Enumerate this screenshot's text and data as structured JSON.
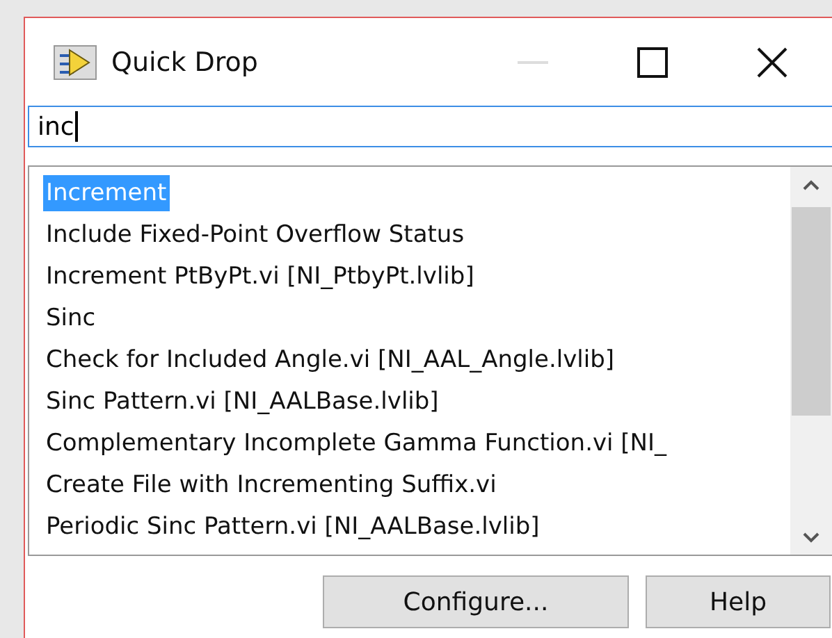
{
  "window": {
    "title": "Quick Drop",
    "minimize_disabled": true
  },
  "search": {
    "value": "inc"
  },
  "results": [
    {
      "label": "Increment",
      "selected": true
    },
    {
      "label": "Include Fixed-Point Overflow Status",
      "selected": false
    },
    {
      "label": "Increment PtByPt.vi [NI_PtbyPt.lvlib]",
      "selected": false
    },
    {
      "label": "Sinc",
      "selected": false
    },
    {
      "label": "Check for Included Angle.vi [NI_AAL_Angle.lvlib]",
      "selected": false
    },
    {
      "label": "Sinc Pattern.vi [NI_AALBase.lvlib]",
      "selected": false
    },
    {
      "label": "Complementary Incomplete Gamma Function.vi [NI_",
      "selected": false
    },
    {
      "label": "Create File with Incrementing Suffix.vi",
      "selected": false
    },
    {
      "label": "Periodic Sinc Pattern.vi [NI_AALBase.lvlib]",
      "selected": false
    }
  ],
  "buttons": [
    "Configure...",
    "Help"
  ]
}
